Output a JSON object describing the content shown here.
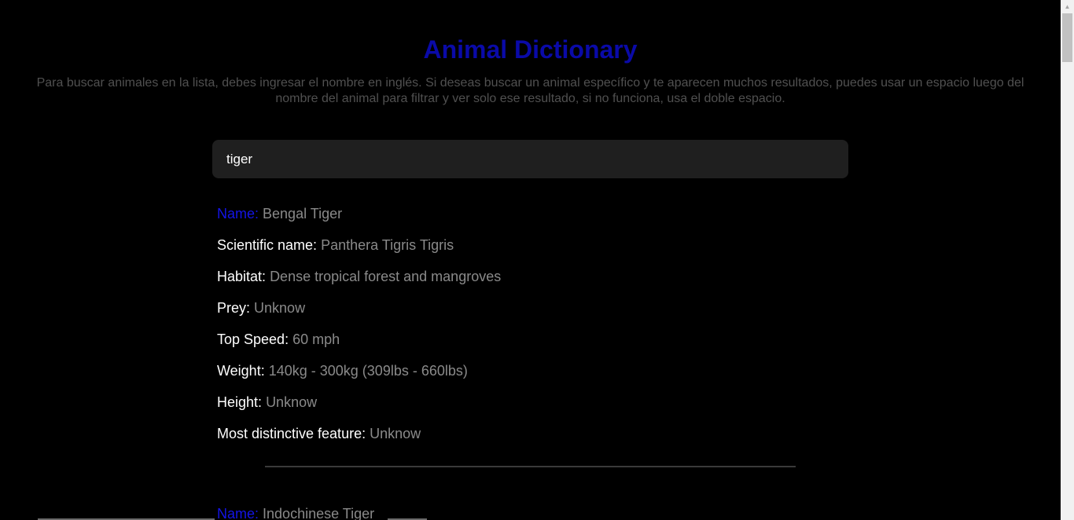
{
  "header": {
    "title": "Animal Dictionary",
    "subtitle": "Para buscar animales en la lista, debes ingresar el nombre en inglés. Si deseas buscar un animal específico y te aparecen muchos resultados, puedes usar un espacio luego del nombre del animal para filtrar y ver solo ese resultado, si no funciona, usa el doble espacio."
  },
  "search": {
    "value": "tiger"
  },
  "labels": {
    "name": "Name:",
    "scientific_name": "Scientific name:",
    "habitat": "Habitat:",
    "prey": "Prey:",
    "top_speed": "Top Speed:",
    "weight": "Weight:",
    "height": "Height:",
    "feature": "Most distinctive feature:"
  },
  "results": [
    {
      "name": "Bengal Tiger",
      "scientific_name": "Panthera Tigris Tigris",
      "habitat": "Dense tropical forest and mangroves",
      "prey": "Unknow",
      "top_speed": "60 mph",
      "weight": "140kg - 300kg (309lbs - 660lbs)",
      "height": "Unknow",
      "feature": "Unknow"
    },
    {
      "name": "Indochinese Tiger"
    }
  ],
  "colors": {
    "title": "#0a0aa8",
    "name_label": "#1414e6",
    "value": "#8a8a8a",
    "background": "#000000"
  }
}
